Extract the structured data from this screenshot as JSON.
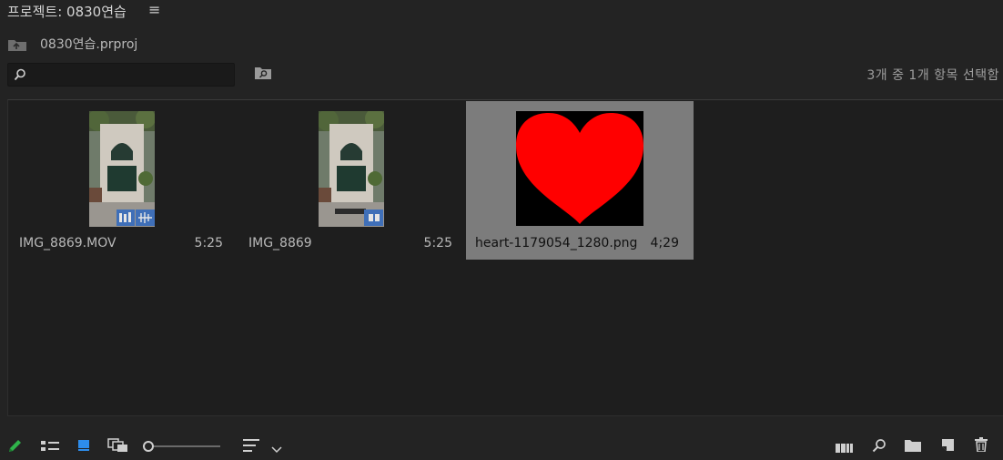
{
  "panel": {
    "title": "프로젝트: 0830연습",
    "menu_icon": "hamburger-menu-icon"
  },
  "project": {
    "name": "0830연습.prproj",
    "icon": "folder-up-icon"
  },
  "search": {
    "value": "",
    "placeholder": "",
    "icon": "search-icon"
  },
  "selection_status": "3개 중 1개 항목 선택함",
  "items": [
    {
      "name": "IMG_8869.MOV",
      "duration": "5:25",
      "selected": false,
      "thumb": "building-photo-video"
    },
    {
      "name": "IMG_8869",
      "duration": "5:25",
      "selected": false,
      "thumb": "building-photo-sequence"
    },
    {
      "name": "heart-1179054_1280.png",
      "duration": "4;29",
      "selected": true,
      "thumb": "red-heart-image"
    }
  ],
  "toolbar": {
    "icons": [
      "pencil-icon",
      "list-view-icon",
      "icon-view-icon",
      "freeform-view-icon",
      "zoom-slider",
      "sort-icon",
      "chevron-down-icon",
      "automate-to-sequence-icon",
      "find-icon",
      "new-bin-icon",
      "new-item-icon",
      "trash-icon"
    ]
  },
  "colors": {
    "accent_blue": "#2d8ceb",
    "pencil_green": "#2fb34a",
    "heart_red": "#ff0000",
    "selected_tile": "#7c7c7c"
  }
}
